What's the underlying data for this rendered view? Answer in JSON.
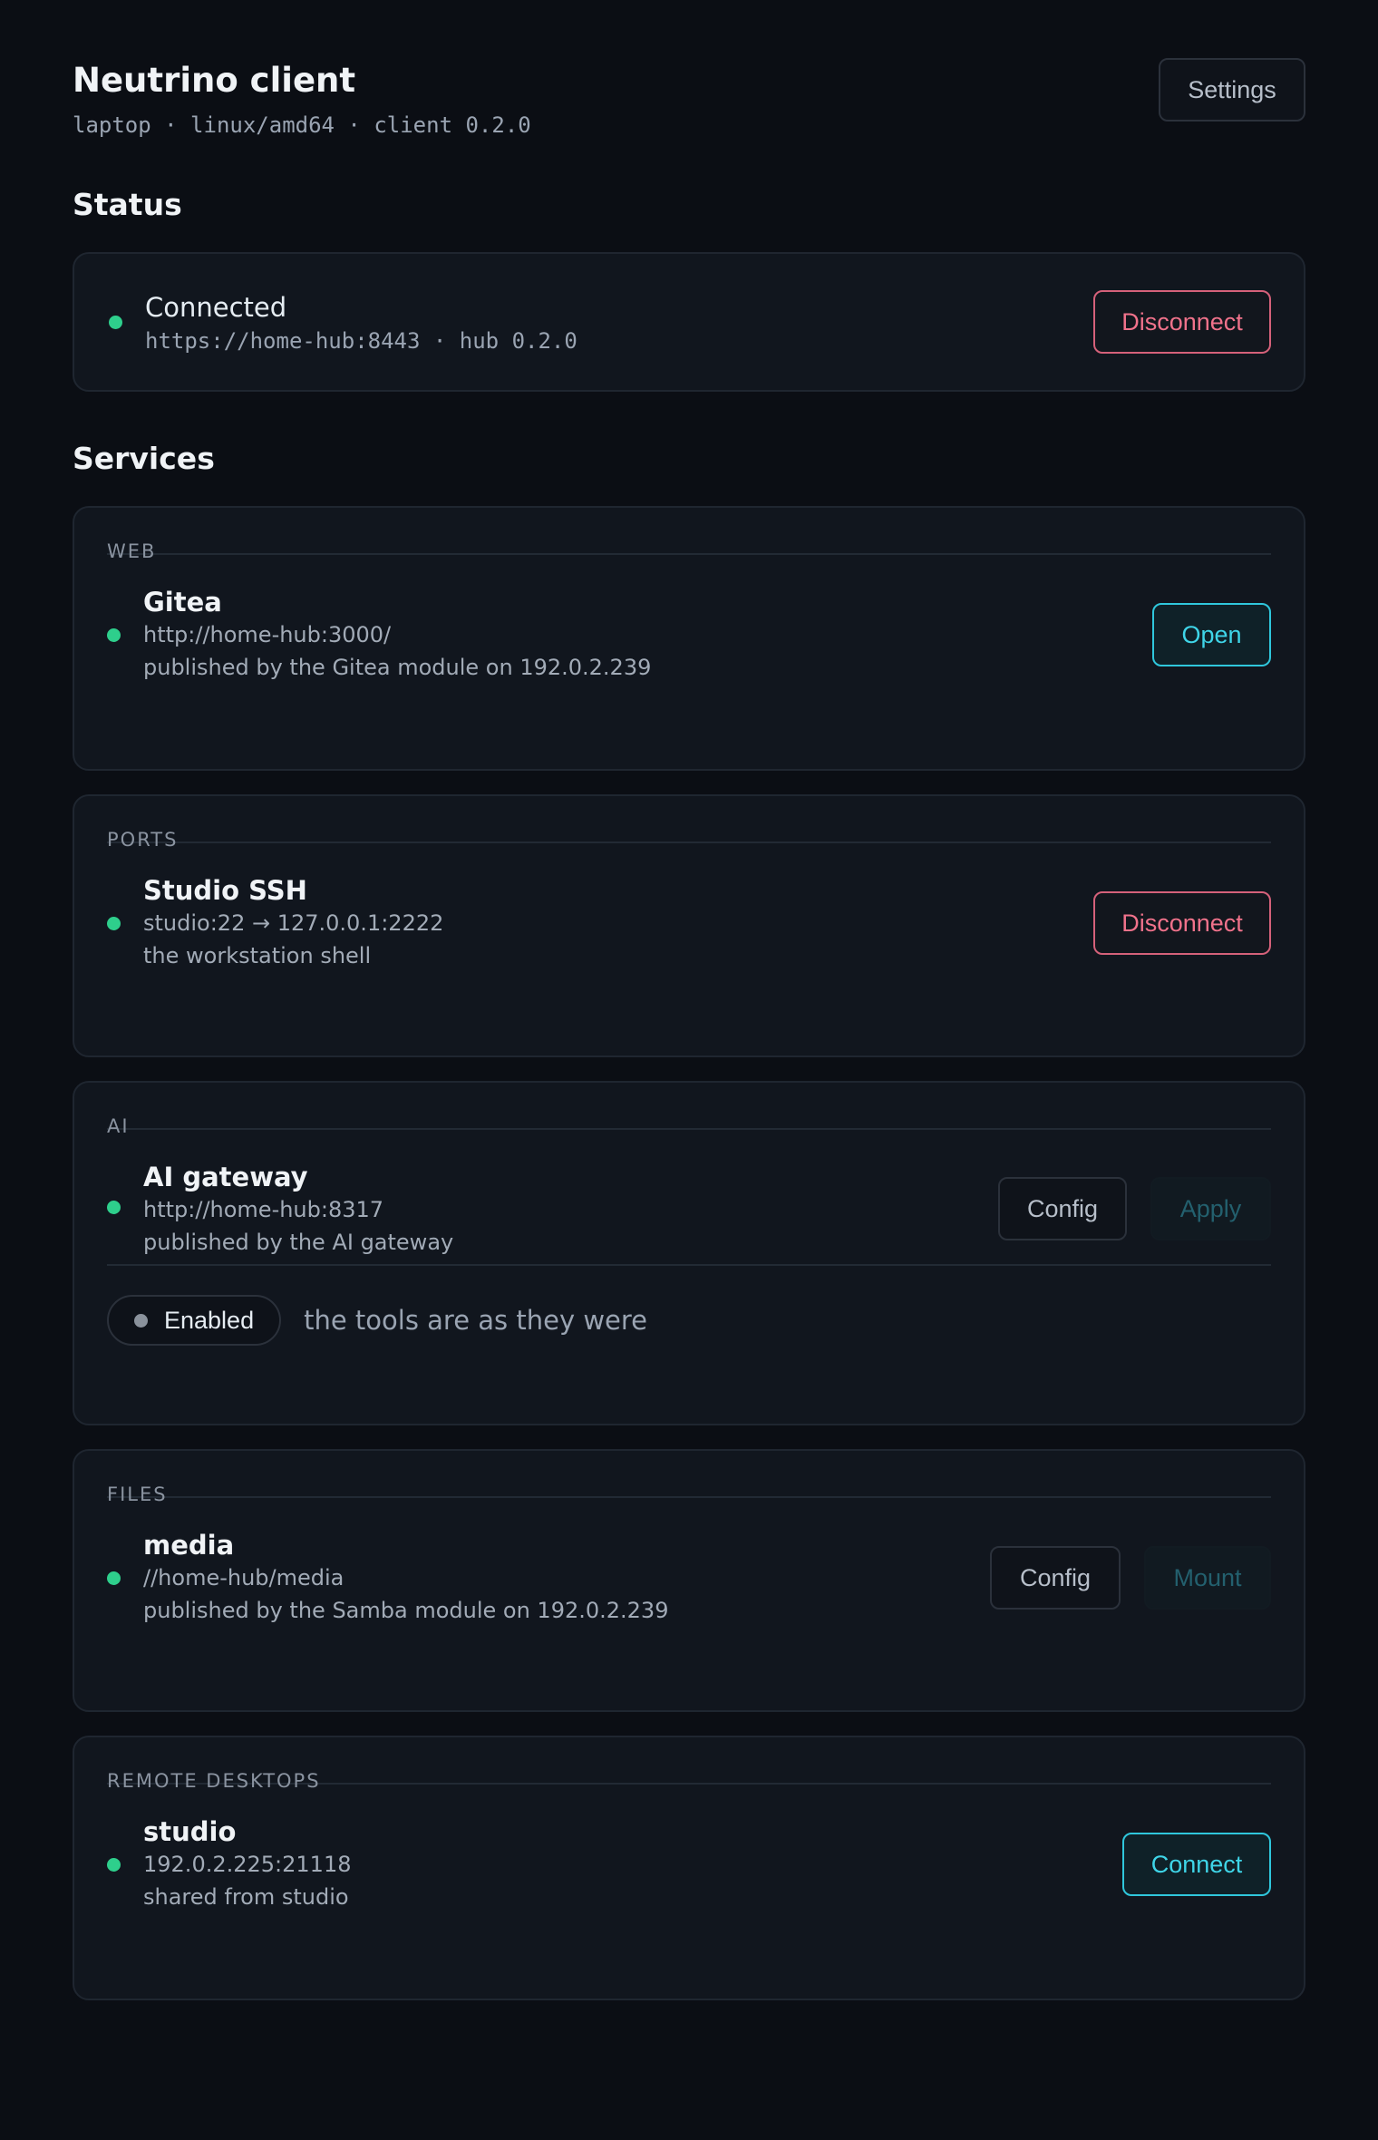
{
  "header": {
    "title": "Neutrino client",
    "subtitle": "laptop · linux/amd64 · client 0.2.0",
    "settings_label": "Settings"
  },
  "status": {
    "section_title": "Status",
    "state": "Connected",
    "endpoint": "https://home-hub:8443 · hub 0.2.0",
    "action_label": "Disconnect"
  },
  "services": {
    "section_title": "Services",
    "web": {
      "category": "WEB",
      "name": "Gitea",
      "url": "http://home-hub:3000/",
      "description": "published by the Gitea module on 192.0.2.239",
      "action_label": "Open"
    },
    "ports": {
      "category": "PORTS",
      "name": "Studio SSH",
      "mapping": "studio:22 → 127.0.0.1:2222",
      "description": "the workstation shell",
      "action_label": "Disconnect"
    },
    "ai": {
      "category": "AI",
      "name": "AI gateway",
      "url": "http://home-hub:8317",
      "description": "published by the AI gateway",
      "config_label": "Config",
      "apply_label": "Apply",
      "toggle_label": "Enabled",
      "toggle_note": "the tools are as they were"
    },
    "files": {
      "category": "FILES",
      "name": "media",
      "path": "//home-hub/media",
      "description": "published by the Samba module on 192.0.2.239",
      "config_label": "Config",
      "mount_label": "Mount"
    },
    "desktops": {
      "category": "REMOTE DESKTOPS",
      "name": "studio",
      "address": "192.0.2.225:21118",
      "description": "shared from studio",
      "action_label": "Connect"
    }
  },
  "colors": {
    "background": "#0b0e14",
    "card": "#11161e",
    "online": "#2ecf8c",
    "danger": "#f0728b",
    "primary": "#3fd5e8"
  }
}
